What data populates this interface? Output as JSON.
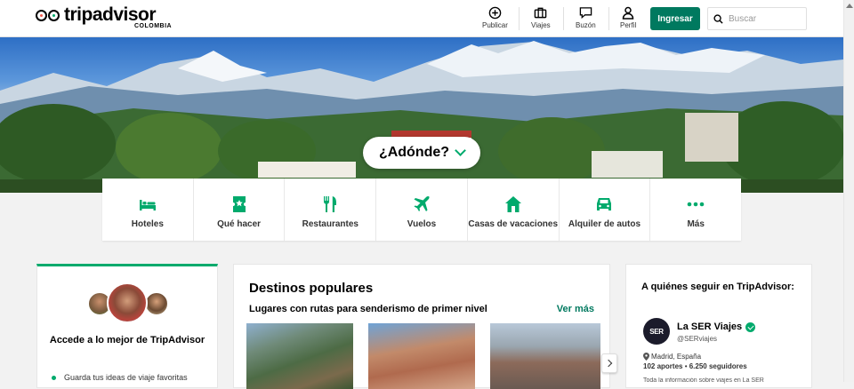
{
  "header": {
    "brand": "tripadvisor",
    "country": "COLOMBIA",
    "nav": [
      {
        "label": "Publicar",
        "icon": "plus-circle-icon"
      },
      {
        "label": "Viajes",
        "icon": "suitcase-icon"
      },
      {
        "label": "Buzón",
        "icon": "chat-icon"
      },
      {
        "label": "Perfil",
        "icon": "user-icon"
      }
    ],
    "login_label": "Ingresar",
    "search_placeholder": "Buscar"
  },
  "hero": {
    "where_label": "¿Adónde?"
  },
  "categories": [
    {
      "label": "Hoteles",
      "icon": "bed-icon"
    },
    {
      "label": "Qué hacer",
      "icon": "ticket-icon"
    },
    {
      "label": "Restaurantes",
      "icon": "cutlery-icon"
    },
    {
      "label": "Vuelos",
      "icon": "plane-icon"
    },
    {
      "label": "Casas de vacaciones",
      "icon": "house-icon"
    },
    {
      "label": "Alquiler de autos",
      "icon": "car-icon"
    },
    {
      "label": "Más",
      "icon": "more-dots-icon"
    }
  ],
  "promo": {
    "title": "Accede a lo mejor de TripAdvisor",
    "bullet": "Guarda tus ideas de viaje favoritas"
  },
  "destinations": {
    "title": "Destinos populares",
    "subtitle": "Lugares con rutas para senderismo de primer nivel",
    "see_more": "Ver más"
  },
  "follow": {
    "title": "A quiénes seguir en TripAdvisor:",
    "avatar_text": "SER",
    "name": "La SER Viajes",
    "handle": "@SERviajes",
    "location": "Madrid, España",
    "contributions": "102 aportes",
    "followers": "6.250 seguidores",
    "description": "Toda la información sobre viajes en La SER"
  },
  "colors": {
    "accent": "#00aa6c",
    "button": "#00795f"
  }
}
